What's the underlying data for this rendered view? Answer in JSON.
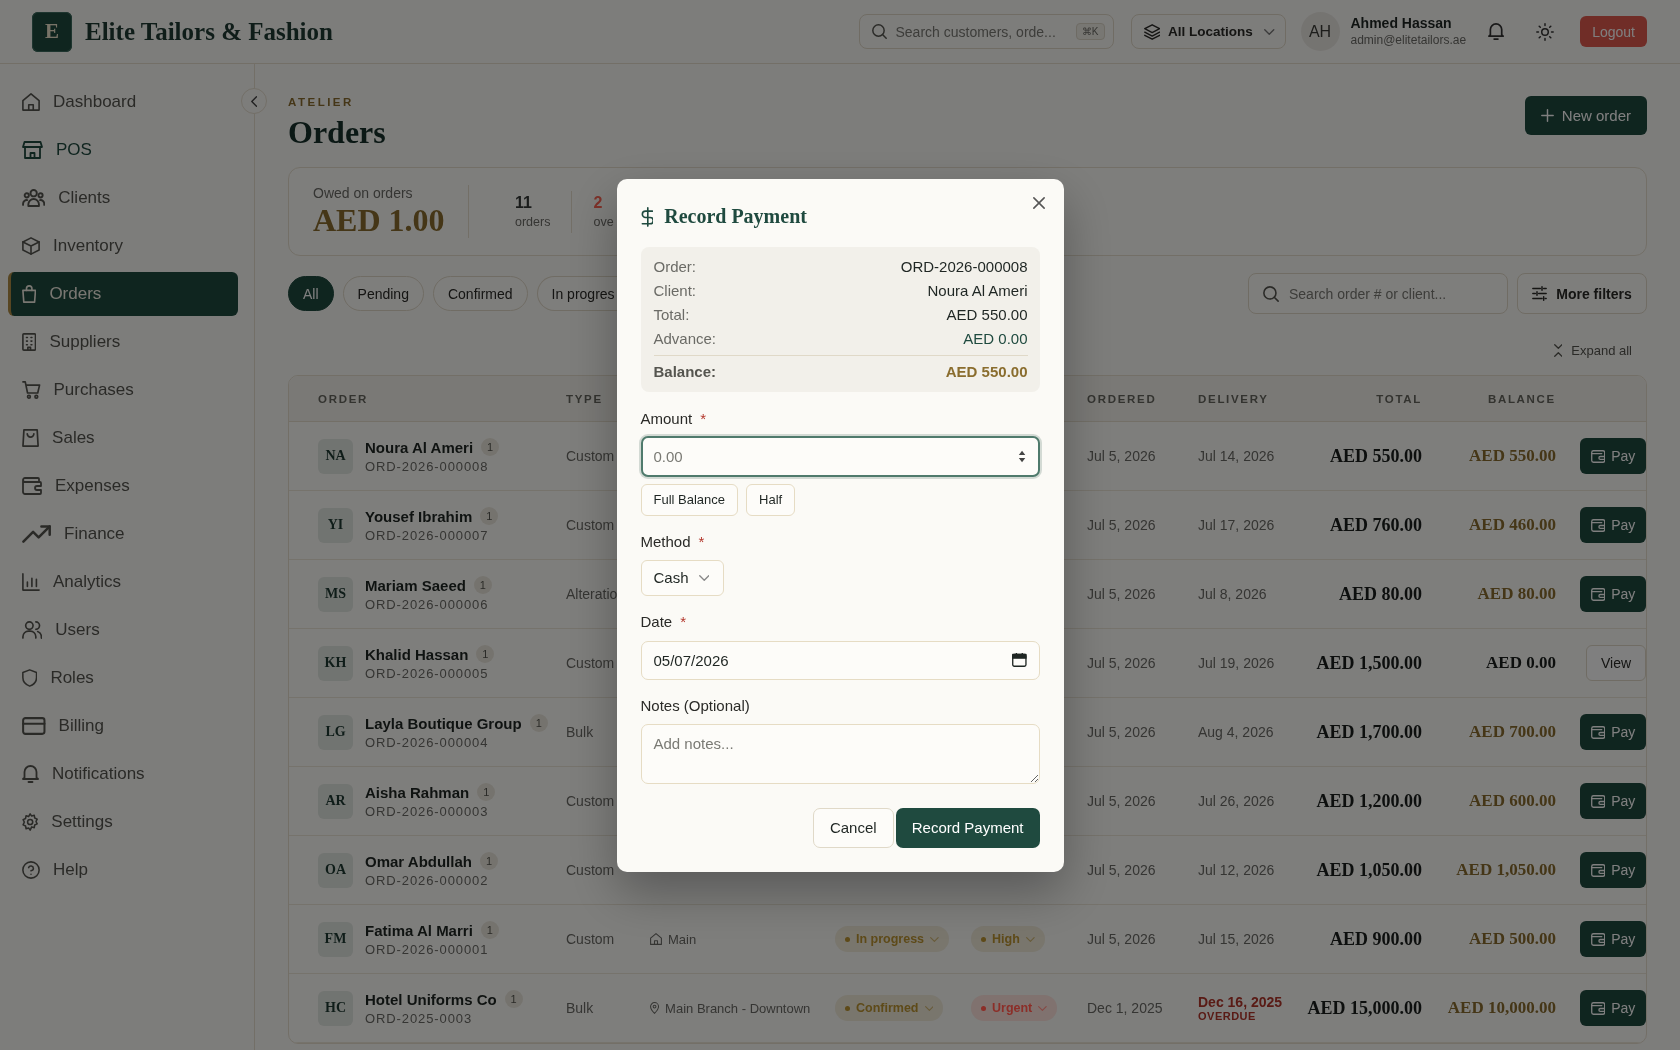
{
  "header": {
    "logo_letter": "E",
    "brand": "Elite Tailors & Fashion",
    "search": {
      "placeholder": "Search customers, orde...",
      "shortcut": "⌘K"
    },
    "location": "All Locations",
    "user": {
      "initials": "AH",
      "name": "Ahmed Hassan",
      "email": "admin@elitetailors.ae"
    },
    "logout": "Logout"
  },
  "sidebar": {
    "items": [
      {
        "label": "Dashboard",
        "selected": false,
        "highlighted": false
      },
      {
        "label": "POS",
        "selected": false,
        "highlighted": true
      },
      {
        "label": "Clients",
        "selected": false,
        "highlighted": false
      },
      {
        "label": "Inventory",
        "selected": false,
        "highlighted": false
      },
      {
        "label": "Orders",
        "selected": true,
        "highlighted": false
      },
      {
        "label": "Suppliers",
        "selected": false,
        "highlighted": false
      },
      {
        "label": "Purchases",
        "selected": false,
        "highlighted": false
      },
      {
        "label": "Sales",
        "selected": false,
        "highlighted": false
      },
      {
        "label": "Expenses",
        "selected": false,
        "highlighted": false
      },
      {
        "label": "Finance",
        "selected": false,
        "highlighted": false
      },
      {
        "label": "Analytics",
        "selected": false,
        "highlighted": false
      },
      {
        "label": "Users",
        "selected": false,
        "highlighted": false
      },
      {
        "label": "Roles",
        "selected": false,
        "highlighted": false
      },
      {
        "label": "Billing",
        "selected": false,
        "highlighted": false
      },
      {
        "label": "Notifications",
        "selected": false,
        "highlighted": false
      },
      {
        "label": "Settings",
        "selected": false,
        "highlighted": false
      },
      {
        "label": "Help",
        "selected": false,
        "highlighted": false
      }
    ]
  },
  "page": {
    "eyebrow": "ATELIER",
    "title": "Orders",
    "new_button": "New order"
  },
  "summary": {
    "owed_label": "Owed on orders",
    "owed_value": "AED 1.00",
    "counts": [
      {
        "value": "11",
        "label": "orders",
        "color": "#1a1c1b"
      },
      {
        "value": "2",
        "label": "ove",
        "color": "#7a3028"
      }
    ]
  },
  "filters": {
    "chips": [
      {
        "label": "All",
        "selected": true
      },
      {
        "label": "Pending",
        "selected": false
      },
      {
        "label": "Confirmed",
        "selected": false
      },
      {
        "label": "In progres",
        "selected": false
      }
    ],
    "search": {
      "placeholder": "Search order # or client..."
    },
    "more_button": "More filters",
    "expand": "Expand all"
  },
  "table": {
    "columns": [
      {
        "kind": "order",
        "label": "ORDER"
      },
      {
        "kind": "type",
        "label": "TYPE"
      },
      {
        "kind": "ordered",
        "label": "ORDERED"
      },
      {
        "kind": "delivery",
        "label": "DELIVERY"
      },
      {
        "kind": "total",
        "label": "TOTAL"
      },
      {
        "kind": "balance",
        "label": "BALANCE"
      }
    ],
    "rows": [
      {
        "initials": "NA",
        "name": "Noura Al Ameri",
        "count": "1",
        "number": "ORD-2026-000008",
        "type": "Custom",
        "ordered": "Jul 5, 2026",
        "delivery": "Jul 14, 2026",
        "overdue": false,
        "total": "AED 550.00",
        "balance": "AED 550.00",
        "balance_due": true,
        "action": {
          "kind": "pay",
          "label": "Pay"
        }
      },
      {
        "initials": "YI",
        "name": "Yousef Ibrahim",
        "count": "1",
        "number": "ORD-2026-000007",
        "type": "Custom",
        "ordered": "Jul 5, 2026",
        "delivery": "Jul 17, 2026",
        "overdue": false,
        "total": "AED 760.00",
        "balance": "AED 460.00",
        "balance_due": true,
        "action": {
          "kind": "pay",
          "label": "Pay"
        }
      },
      {
        "initials": "MS",
        "name": "Mariam Saeed",
        "count": "1",
        "number": "ORD-2026-000006",
        "type": "Alteratio",
        "ordered": "Jul 5, 2026",
        "delivery": "Jul 8, 2026",
        "overdue": false,
        "total": "AED 80.00",
        "balance": "AED 80.00",
        "balance_due": true,
        "action": {
          "kind": "pay",
          "label": "Pay"
        }
      },
      {
        "initials": "KH",
        "name": "Khalid Hassan",
        "count": "1",
        "number": "ORD-2026-000005",
        "type": "Custom",
        "ordered": "Jul 5, 2026",
        "delivery": "Jul 19, 2026",
        "overdue": false,
        "total": "AED 1,500.00",
        "balance": "AED 0.00",
        "balance_due": false,
        "action": {
          "kind": "view",
          "label": "View"
        }
      },
      {
        "initials": "LG",
        "name": "Layla Boutique Group",
        "count": "1",
        "number": "ORD-2026-000004",
        "type": "Bulk",
        "ordered": "Jul 5, 2026",
        "delivery": "Aug 4, 2026",
        "overdue": false,
        "total": "AED 1,700.00",
        "balance": "AED 700.00",
        "balance_due": true,
        "action": {
          "kind": "pay",
          "label": "Pay"
        }
      },
      {
        "initials": "AR",
        "name": "Aisha Rahman",
        "count": "1",
        "number": "ORD-2026-000003",
        "type": "Custom",
        "ordered": "Jul 5, 2026",
        "delivery": "Jul 26, 2026",
        "overdue": false,
        "total": "AED 1,200.00",
        "balance": "AED 600.00",
        "balance_due": true,
        "action": {
          "kind": "pay",
          "label": "Pay"
        }
      },
      {
        "initials": "OA",
        "name": "Omar Abdullah",
        "count": "1",
        "number": "ORD-2026-000002",
        "type": "Custom",
        "ordered": "Jul 5, 2026",
        "delivery": "Jul 12, 2026",
        "overdue": false,
        "total": "AED 1,050.00",
        "balance": "AED 1,050.00",
        "balance_due": true,
        "action": {
          "kind": "pay",
          "label": "Pay"
        }
      },
      {
        "initials": "FM",
        "name": "Fatima Al Marri",
        "count": "1",
        "number": "ORD-2026-000001",
        "type": "Custom",
        "location": {
          "kind": "home",
          "label": "Main"
        },
        "status": {
          "label": "In progress",
          "color": "#5e4a18"
        },
        "priority": {
          "label": "High",
          "color": "#5e4a18"
        },
        "ordered": "Jul 5, 2026",
        "delivery": "Jul 15, 2026",
        "overdue": false,
        "total": "AED 900.00",
        "balance": "AED 500.00",
        "balance_due": true,
        "action": {
          "kind": "pay",
          "label": "Pay"
        }
      },
      {
        "initials": "HC",
        "name": "Hotel Uniforms Co",
        "count": "1",
        "number": "ORD-2025-0003",
        "type": "Bulk",
        "location": {
          "kind": "pin",
          "label": "Main Branch - Downtown"
        },
        "status": {
          "label": "Confirmed",
          "color": "#5e4a18"
        },
        "priority": {
          "label": "Urgent",
          "color": "#8c2e28"
        },
        "ordered": "Dec 1, 2025",
        "delivery": "Dec 16, 2025",
        "overdue": true,
        "overdue_label": "OVERDUE",
        "total": "AED 15,000.00",
        "balance": "AED 10,000.00",
        "balance_due": true,
        "action": {
          "kind": "pay",
          "label": "Pay"
        }
      }
    ]
  },
  "modal": {
    "title": "Record Payment",
    "summary": [
      {
        "label": "Order:",
        "value": "ORD-2026-000008",
        "kind": "plain"
      },
      {
        "label": "Client:",
        "value": "Noura Al Ameri",
        "kind": "plain"
      },
      {
        "label": "Total:",
        "value": "AED 550.00",
        "kind": "plain"
      },
      {
        "label": "Advance:",
        "value": "AED 0.00",
        "kind": "paid"
      },
      {
        "label": "Balance:",
        "value": "AED 550.00",
        "kind": "balance"
      }
    ],
    "amount": {
      "label": "Amount",
      "required_mark": "*",
      "placeholder": "0.00",
      "focused": true
    },
    "quick_buttons": [
      "Full Balance",
      "Half"
    ],
    "method": {
      "label": "Method",
      "required_mark": "*",
      "value": "Cash"
    },
    "date": {
      "label": "Date",
      "required_mark": "*",
      "value": "05/07/2026"
    },
    "notes": {
      "label": "Notes (Optional)",
      "placeholder": "Add notes..."
    },
    "cancel": "Cancel",
    "submit": "Record Payment"
  }
}
